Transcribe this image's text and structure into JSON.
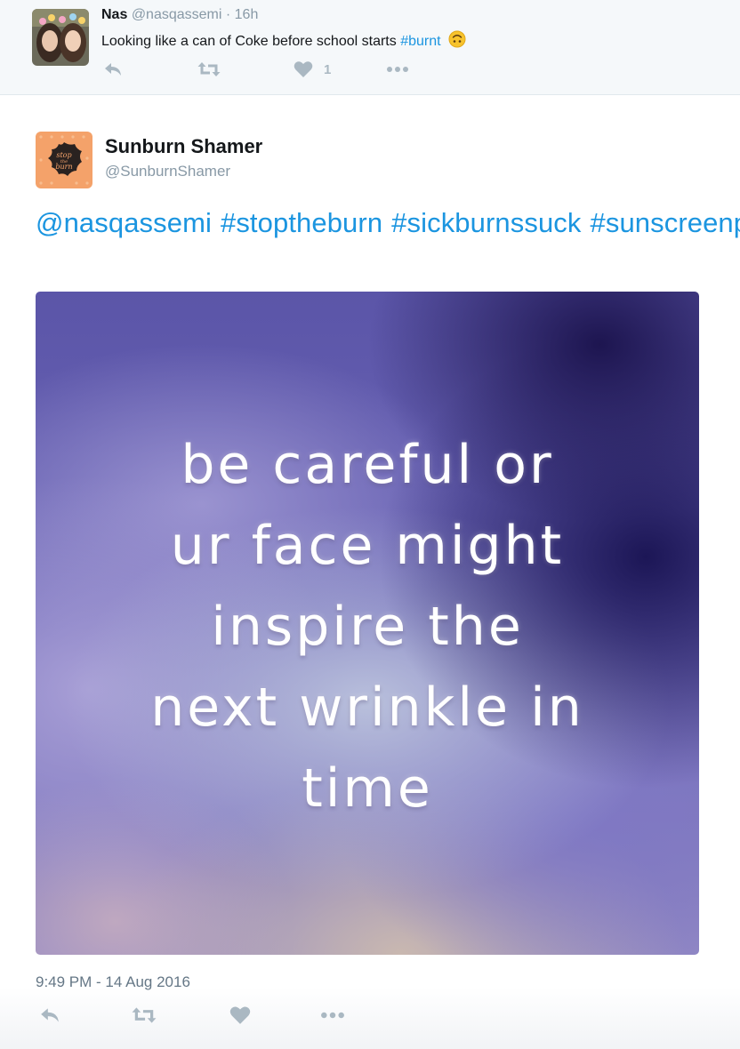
{
  "parent_tweet": {
    "display_name": "Nas",
    "handle": "@nasqassemi",
    "time": "16h",
    "text": "Looking like a can of Coke before school starts",
    "hashtag": "#burnt",
    "emoji": "upside-down-face",
    "like_count": "1",
    "icons": [
      "reply-icon",
      "retweet-icon",
      "heart-icon",
      "more-icon"
    ]
  },
  "main_tweet": {
    "display_name": "Sunburn Shamer",
    "handle": "@SunburnShamer",
    "avatar_label": "stop the burn",
    "text_tokens": [
      "@nasqassemi",
      "#stoptheburn",
      "#sickburnssuck",
      "#sunscreenpls"
    ],
    "image_text_lines": [
      "be careful or",
      "ur face might",
      "inspire the",
      "next wrinkle in",
      "time"
    ],
    "timestamp": "9:49 PM - 14 Aug 2016",
    "icons": [
      "reply-icon",
      "retweet-icon",
      "heart-icon",
      "more-icon"
    ]
  },
  "colors": {
    "link": "#1b95e0",
    "secondary_text": "#8899a6",
    "action_icon": "#aab8c2",
    "parent_background": "#f5f8fa",
    "avatar_orange": "#f4a26a"
  }
}
